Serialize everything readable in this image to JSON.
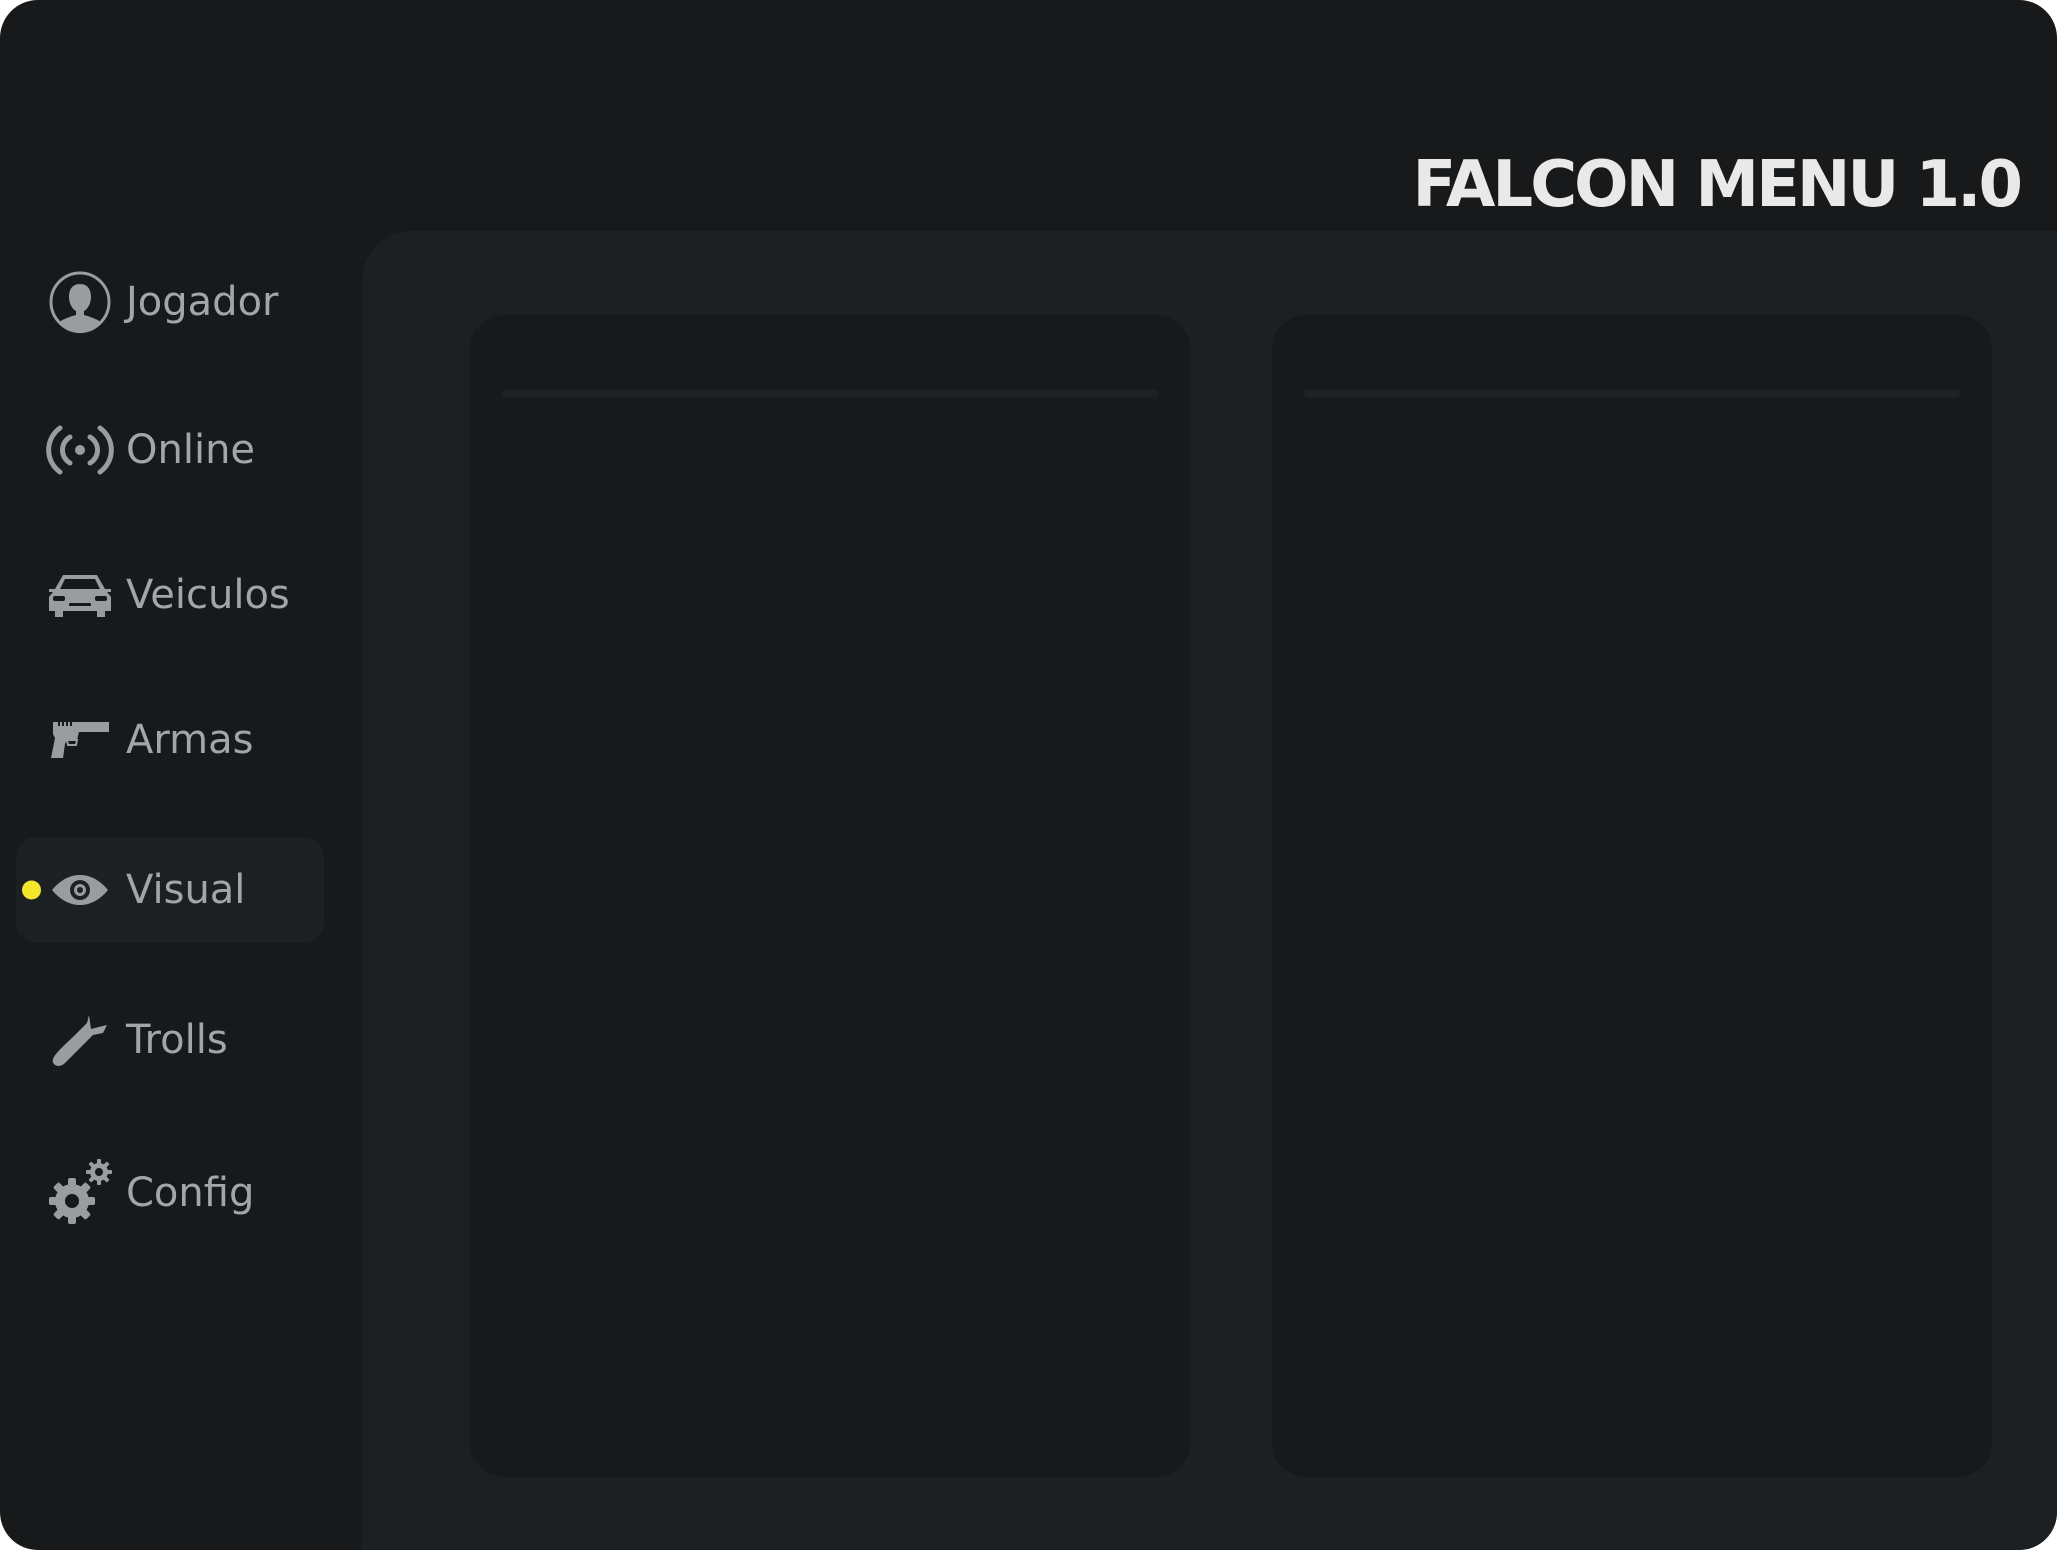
{
  "app": {
    "title": "FALCON MENU 1.0"
  },
  "sidebar": {
    "items": [
      {
        "label": "Jogador",
        "icon": "user-icon",
        "active": false
      },
      {
        "label": "Online",
        "icon": "broadcast-icon",
        "active": false
      },
      {
        "label": "Veiculos",
        "icon": "car-icon",
        "active": false
      },
      {
        "label": "Armas",
        "icon": "pistol-icon",
        "active": false
      },
      {
        "label": "Visual",
        "icon": "eye-icon",
        "active": true
      },
      {
        "label": "Trolls",
        "icon": "bomb-icon",
        "active": false
      },
      {
        "label": "Config",
        "icon": "gears-icon",
        "active": false
      }
    ]
  },
  "colors": {
    "background": "#17191b",
    "content_background": "#1d2022",
    "panel_background": "#17191b",
    "title_text": "#e9e9e9",
    "nav_text": "#a3a5a7",
    "icon": "#9a9c9e",
    "accent": "#f4e62d"
  }
}
